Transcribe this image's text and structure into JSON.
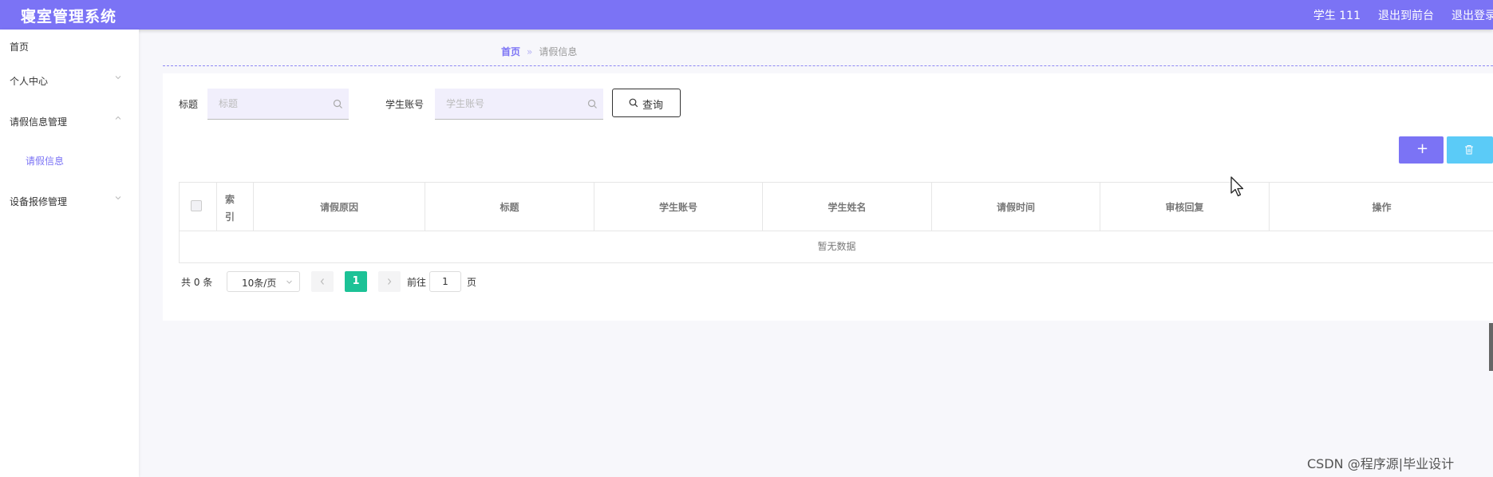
{
  "header": {
    "app_title": "寝室管理系统",
    "user": "学生 111",
    "back_to_front": "退出到前台",
    "logout": "退出登录"
  },
  "sidebar": {
    "items": [
      {
        "label": "首页"
      },
      {
        "label": "个人中心"
      },
      {
        "label": "请假信息管理"
      },
      {
        "label": "请假信息"
      },
      {
        "label": "设备报修管理"
      }
    ]
  },
  "breadcrumb": {
    "home": "首页",
    "sep": "»",
    "current": "请假信息"
  },
  "search": {
    "title_label": "标题",
    "title_placeholder": "标题",
    "account_label": "学生账号",
    "account_placeholder": "学生账号",
    "query_button": "查询"
  },
  "actions": {
    "add": "+"
  },
  "table": {
    "columns": {
      "index_line1": "索",
      "index_line2": "引",
      "reason": "请假原因",
      "title": "标题",
      "account": "学生账号",
      "name": "学生姓名",
      "time": "请假时间",
      "reply": "审核回复",
      "op": "操作"
    },
    "empty_text": "暂无数据"
  },
  "pagination": {
    "total": "共 0 条",
    "page_size": "10条/页",
    "current_page": "1",
    "goto_label": "前往",
    "goto_value": "1",
    "goto_unit": "页"
  },
  "watermark": "CSDN @程序源|毕业设计",
  "colors": {
    "primary": "#7b73f5",
    "delete": "#5bcbf7",
    "page_active": "#1cc296"
  }
}
